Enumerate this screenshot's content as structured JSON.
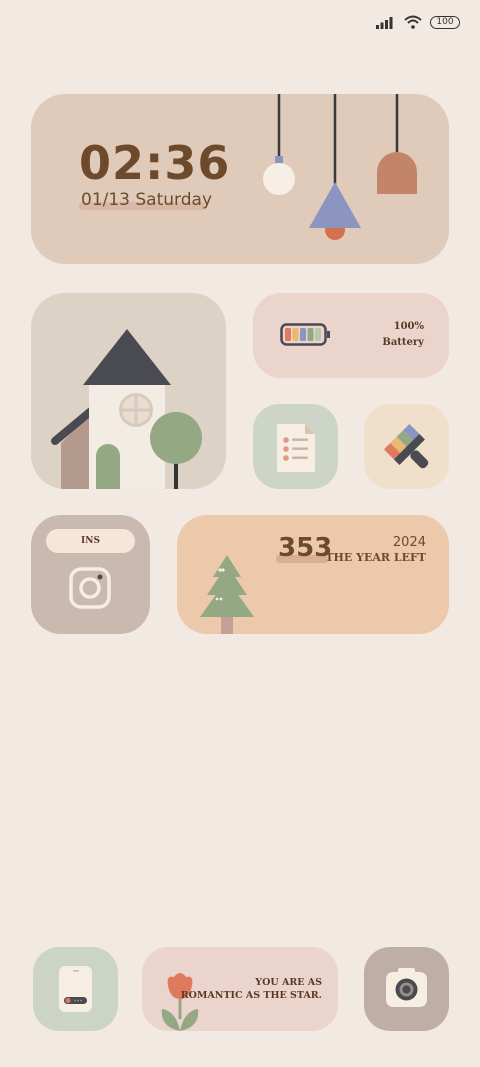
{
  "status_bar": {
    "battery_level": "100"
  },
  "clock": {
    "time": "02:36",
    "date": "01/13  Saturday"
  },
  "battery_widget": {
    "percent": "100%",
    "label": "Battery"
  },
  "ins_widget": {
    "label": "INS"
  },
  "year_widget": {
    "days_left": "353",
    "year": "2024",
    "label": "THE YEAR LEFT"
  },
  "quote_widget": {
    "line1": "YOU  ARE AS",
    "line2": "ROMANTIC AS THE STAR."
  },
  "colors": {
    "background": "#f3e9e3",
    "text_brown": "#6e4a2c",
    "clock_bg": "#e0cbbb",
    "year_bg": "#ecc9ab"
  }
}
